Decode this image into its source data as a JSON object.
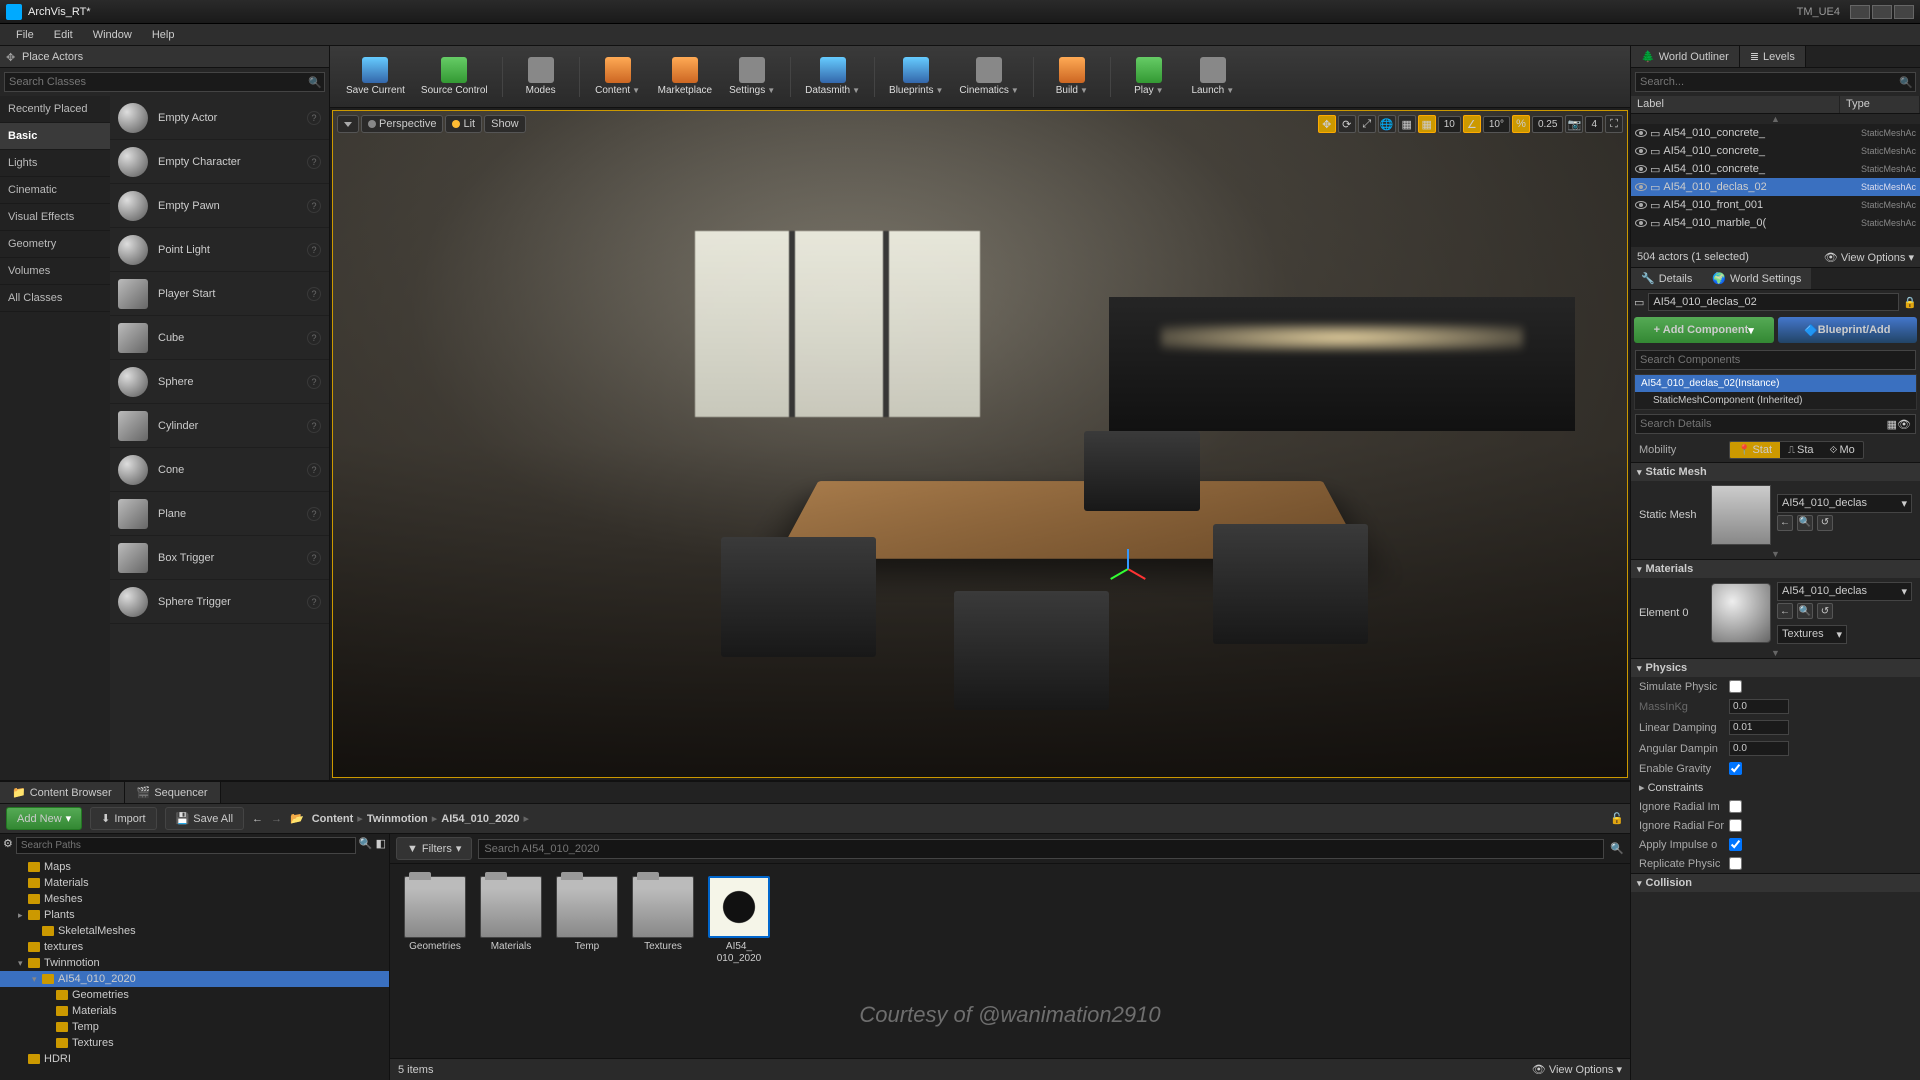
{
  "titlebar": {
    "title": "ArchVis_RT*",
    "project": "TM_UE4"
  },
  "menubar": [
    "File",
    "Edit",
    "Window",
    "Help"
  ],
  "placeActors": {
    "title": "Place Actors",
    "searchPlaceholder": "Search Classes",
    "categories": [
      "Recently Placed",
      "Basic",
      "Lights",
      "Cinematic",
      "Visual Effects",
      "Geometry",
      "Volumes",
      "All Classes"
    ],
    "selectedCategory": "Basic",
    "items": [
      "Empty Actor",
      "Empty Character",
      "Empty Pawn",
      "Point Light",
      "Player Start",
      "Cube",
      "Sphere",
      "Cylinder",
      "Cone",
      "Plane",
      "Box Trigger",
      "Sphere Trigger"
    ]
  },
  "toolbar": [
    {
      "label": "Save Current",
      "cls": "blue"
    },
    {
      "label": "Source Control",
      "cls": "green"
    },
    {
      "label": "Modes",
      "cls": ""
    },
    {
      "label": "Content",
      "cls": "orange",
      "dd": true
    },
    {
      "label": "Marketplace",
      "cls": "orange"
    },
    {
      "label": "Settings",
      "cls": "",
      "dd": true
    },
    {
      "label": "Datasmith",
      "cls": "blue",
      "dd": true
    },
    {
      "label": "Blueprints",
      "cls": "blue",
      "dd": true
    },
    {
      "label": "Cinematics",
      "cls": "",
      "dd": true
    },
    {
      "label": "Build",
      "cls": "orange",
      "dd": true
    },
    {
      "label": "Play",
      "cls": "green",
      "dd": true
    },
    {
      "label": "Launch",
      "cls": "",
      "dd": true
    }
  ],
  "viewport": {
    "modeBtn": "Perspective",
    "litBtn": "Lit",
    "showBtn": "Show",
    "snap": {
      "grid": "10",
      "angle": "10°",
      "scale": "0.25",
      "cam": "4"
    }
  },
  "outliner": {
    "tab1": "World Outliner",
    "tab2": "Levels",
    "searchPlaceholder": "Search...",
    "colLabel": "Label",
    "colType": "Type",
    "rows": [
      {
        "label": "AI54_010_concrete_",
        "type": "StaticMeshAc"
      },
      {
        "label": "AI54_010_concrete_",
        "type": "StaticMeshAc"
      },
      {
        "label": "AI54_010_concrete_",
        "type": "StaticMeshAc"
      },
      {
        "label": "AI54_010_declas_02",
        "type": "StaticMeshAc",
        "sel": true
      },
      {
        "label": "AI54_010_front_001",
        "type": "StaticMeshAc"
      },
      {
        "label": "AI54_010_marble_0(",
        "type": "StaticMeshAc"
      }
    ],
    "status": "504 actors (1 selected)",
    "viewOptions": "View Options"
  },
  "details": {
    "tab1": "Details",
    "tab2": "World Settings",
    "objectName": "AI54_010_declas_02",
    "addComponent": "+ Add Component",
    "blueprintAdd": "Blueprint/Add",
    "searchCompPlaceholder": "Search Components",
    "compRoot": "AI54_010_declas_02(Instance)",
    "compChild": "StaticMeshComponent (Inherited)",
    "searchDetailsPlaceholder": "Search Details",
    "mobilityLabel": "Mobility",
    "mobility": [
      "Stat",
      "Sta",
      "Mo"
    ],
    "sectStaticMesh": "Static Mesh",
    "staticMeshLabel": "Static Mesh",
    "staticMeshAsset": "AI54_010_declas",
    "sectMaterials": "Materials",
    "elementLabel": "Element 0",
    "materialAsset": "AI54_010_declas",
    "texturesBtn": "Textures",
    "sectPhysics": "Physics",
    "physProps": {
      "simulate": "Simulate Physic",
      "massKg": "MassInKg",
      "massVal": "0.0",
      "linDamp": "Linear Damping",
      "linVal": "0.01",
      "angDamp": "Angular Dampin",
      "angVal": "0.0",
      "gravity": "Enable Gravity",
      "constraints": "Constraints",
      "ignoreImp": "Ignore Radial Im",
      "ignoreFor": "Ignore Radial For",
      "applyImp": "Apply Impulse o",
      "replicate": "Replicate Physic"
    },
    "sectCollision": "Collision"
  },
  "contentBrowser": {
    "tab1": "Content Browser",
    "tab2": "Sequencer",
    "addNew": "Add New",
    "import": "Import",
    "saveAll": "Save All",
    "crumbs": [
      "Content",
      "Twinmotion",
      "AI54_010_2020"
    ],
    "searchPathsPlaceholder": "Search Paths",
    "tree": [
      {
        "l": "Maps",
        "d": 1
      },
      {
        "l": "Materials",
        "d": 1
      },
      {
        "l": "Meshes",
        "d": 1
      },
      {
        "l": "Plants",
        "d": 1,
        "exp": true
      },
      {
        "l": "SkeletalMeshes",
        "d": 2
      },
      {
        "l": "textures",
        "d": 1
      },
      {
        "l": "Twinmotion",
        "d": 1,
        "exp": true,
        "open": true
      },
      {
        "l": "AI54_010_2020",
        "d": 2,
        "exp": true,
        "sel": true,
        "open": true
      },
      {
        "l": "Geometries",
        "d": 3
      },
      {
        "l": "Materials",
        "d": 3
      },
      {
        "l": "Temp",
        "d": 3
      },
      {
        "l": "Textures",
        "d": 3
      },
      {
        "l": "HDRI",
        "d": 1
      }
    ],
    "filters": "Filters",
    "assetSearchPlaceholder": "Search AI54_010_2020",
    "assets": [
      {
        "label": "Geometries",
        "type": "folder"
      },
      {
        "label": "Materials",
        "type": "folder"
      },
      {
        "label": "Temp",
        "type": "folder"
      },
      {
        "label": "Textures",
        "type": "folder"
      },
      {
        "label": "AI54_010_2020",
        "type": "tex"
      }
    ],
    "itemCount": "5 items",
    "viewOptions": "View Options",
    "watermark": "Courtesy of @wanimation2910"
  }
}
